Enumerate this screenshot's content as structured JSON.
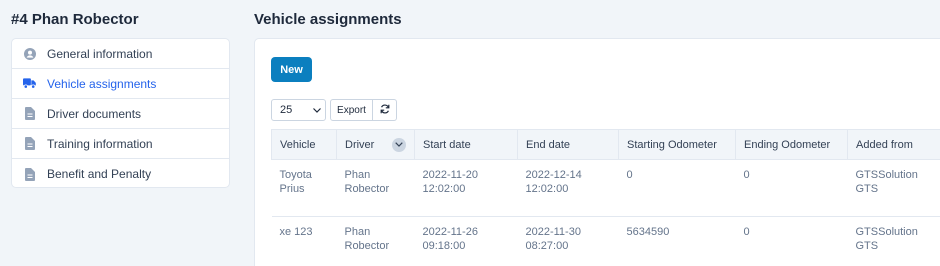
{
  "sidebar": {
    "title": "#4 Phan Robector",
    "items": [
      {
        "label": "General information",
        "icon": "user-circle-icon"
      },
      {
        "label": "Vehicle assignments",
        "icon": "truck-icon",
        "active": true
      },
      {
        "label": "Driver documents",
        "icon": "document-icon"
      },
      {
        "label": "Training information",
        "icon": "document-icon"
      },
      {
        "label": "Benefit and Penalty",
        "icon": "document-icon"
      }
    ]
  },
  "main": {
    "title": "Vehicle assignments",
    "new_label": "New",
    "page_size": "25",
    "export_label": "Export",
    "columns": [
      "Vehicle",
      "Driver",
      "Start date",
      "End date",
      "Starting Odometer",
      "Ending Odometer",
      "Added from"
    ],
    "rows": [
      {
        "vehicle": "Toyota Prius",
        "driver": "Phan Robector",
        "start": "2022-11-20 12:02:00",
        "end": "2022-12-14 12:02:00",
        "start_odo": "0",
        "end_odo": "0",
        "added_from": "GTSSolution GTS"
      },
      {
        "vehicle": "xe 123",
        "driver": "Phan Robector",
        "start": "2022-11-26 09:18:00",
        "end": "2022-11-30 08:27:00",
        "start_odo": "5634590",
        "end_odo": "0",
        "added_from": "GTSSolution GTS"
      }
    ]
  },
  "colors": {
    "accent": "#2563eb",
    "button": "#0b7fbf"
  }
}
